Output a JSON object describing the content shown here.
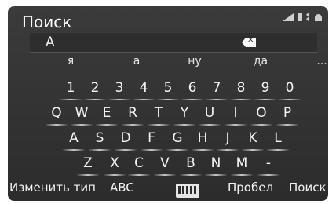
{
  "header": {
    "title": "Поиск"
  },
  "input": {
    "value": "A"
  },
  "suggestions": [
    "я",
    "а",
    "ну",
    "да",
    "..."
  ],
  "keyboard": {
    "row1": [
      "1",
      "2",
      "3",
      "4",
      "5",
      "6",
      "7",
      "8",
      "9",
      "0"
    ],
    "row2": [
      "Q",
      "W",
      "E",
      "R",
      "T",
      "Y",
      "U",
      "I",
      "O",
      "P"
    ],
    "row3": [
      "A",
      "S",
      "D",
      "F",
      "G",
      "H",
      "J",
      "K",
      "L"
    ],
    "row4": [
      "Z",
      "X",
      "C",
      "V",
      "B",
      "N",
      "M",
      "-"
    ]
  },
  "bottom": {
    "change_type": "Изменить тип",
    "abc": "ABC",
    "space": "Пробел",
    "search": "Поиск"
  },
  "icons": [
    "signal-icon",
    "battery-icon",
    "bluetooth-icon",
    "wifi-icon",
    "backspace-icon",
    "keyboard-icon"
  ]
}
